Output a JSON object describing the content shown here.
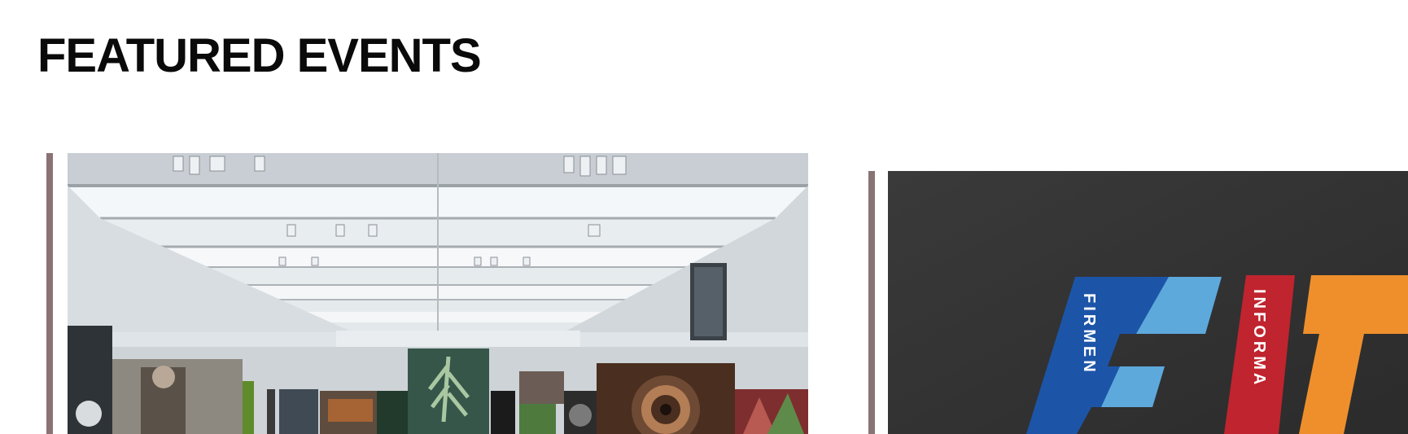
{
  "section": {
    "title": "FEATURED EVENTS"
  },
  "events": [
    {
      "image_icon": "gallery-exhibition-image",
      "accent_color": "#8a7375"
    },
    {
      "image_icon": "fit-logo-image",
      "accent_color": "#8a7375",
      "logo_word_1": "FIRMEN",
      "logo_word_2": "INFORMA"
    }
  ]
}
